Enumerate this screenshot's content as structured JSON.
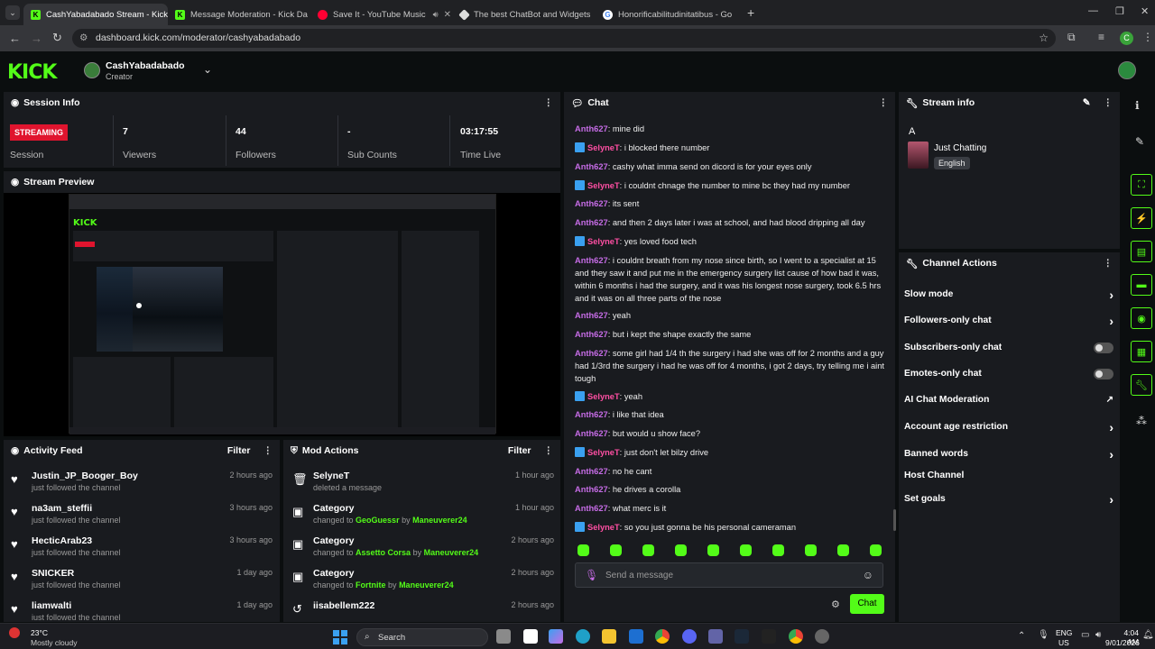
{
  "browser": {
    "tabs": [
      {
        "title": "CashYabadabado Stream - Kick",
        "color": "#53fc18"
      },
      {
        "title": "Message Moderation - Kick Da",
        "color": "#53fc18"
      },
      {
        "title": "Save It - YouTube Music",
        "color": "#ff0033"
      },
      {
        "title": "The best ChatBot and Widgets",
        "color": "#dddddd"
      },
      {
        "title": "Honorificabilitudinitatibus - Go",
        "color": "#ffffff"
      }
    ],
    "url": "dashboard.kick.com/moderator/cashyabadabado"
  },
  "header": {
    "logo": "KICK",
    "channel": "CashYabadabado",
    "role": "Creator"
  },
  "session": {
    "title": "Session Info",
    "status": "STREAMING",
    "status_label": "Session",
    "viewers": "7",
    "viewers_label": "Viewers",
    "followers": "44",
    "followers_label": "Followers",
    "subs": "-",
    "subs_label": "Sub Counts",
    "time": "03:17:55",
    "time_label": "Time Live"
  },
  "preview": {
    "title": "Stream Preview"
  },
  "activity": {
    "title": "Activity Feed",
    "filter": "Filter",
    "items": [
      {
        "name": "Justin_JP_Booger_Boy",
        "sub": "just followed the channel",
        "time": "2 hours ago"
      },
      {
        "name": "na3am_steffii",
        "sub": "just followed the channel",
        "time": "3 hours ago"
      },
      {
        "name": "HecticArab23",
        "sub": "just followed the channel",
        "time": "3 hours ago"
      },
      {
        "name": "SNICKER",
        "sub": "just followed the channel",
        "time": "1 day ago"
      },
      {
        "name": "liamwalti",
        "sub": "just followed the channel",
        "time": "1 day ago"
      }
    ]
  },
  "mod": {
    "title": "Mod Actions",
    "filter": "Filter",
    "items": [
      {
        "name": "SelyneT",
        "sub": "deleted a message",
        "time": "1 hour ago"
      },
      {
        "name": "Category",
        "pre": "changed to ",
        "game": "GeoGuessr",
        "by": " by ",
        "who": "Maneuverer24",
        "time": "1 hour ago"
      },
      {
        "name": "Category",
        "pre": "changed to ",
        "game": "Assetto Corsa",
        "by": " by ",
        "who": "Maneuverer24",
        "time": "2 hours ago"
      },
      {
        "name": "Category",
        "pre": "changed to ",
        "game": "Fortnite",
        "by": " by ",
        "who": "Maneuverer24",
        "time": "2 hours ago"
      },
      {
        "name": "iisabellem222",
        "sub": "",
        "time": "2 hours ago"
      }
    ]
  },
  "chat": {
    "title": "Chat",
    "placeholder": "Send a message",
    "send": "Chat",
    "messages": [
      {
        "user": "Anth627",
        "text": "mine did",
        "badge": false
      },
      {
        "user": "SelyneT",
        "text": "i blocked there number",
        "badge": true
      },
      {
        "user": "Anth627",
        "text": "cashy what imma send on dicord is for your eyes only",
        "badge": false
      },
      {
        "user": "SelyneT",
        "text": "i couldnt chnage the number to mine bc they had my number",
        "badge": true
      },
      {
        "user": "Anth627",
        "text": "its sent",
        "badge": false
      },
      {
        "user": "Anth627",
        "text": "and then 2 days later i was at school, and had blood dripping all day",
        "badge": false
      },
      {
        "user": "SelyneT",
        "text": "yes loved food tech",
        "badge": true
      },
      {
        "user": "Anth627",
        "text": "i couldnt breath from my nose since birth, so I went to a specialist at 15 and they saw it and put me in the emergency surgery list cause of how bad it was, within 6 months i had the surgery, and it was his longest nose surgery, took 6.5 hrs and it was on all three parts of the nose",
        "badge": false
      },
      {
        "user": "Anth627",
        "text": "yeah",
        "badge": false
      },
      {
        "user": "Anth627",
        "text": "but i kept the shape exactly the same",
        "badge": false
      },
      {
        "user": "Anth627",
        "text": "some girl had 1/4 th the surgery i had she was off for 2 months and a guy had 1/3rd the surgery i had he was off for 4 months, i got 2 days, try telling me i aint tough",
        "badge": false
      },
      {
        "user": "SelyneT",
        "text": "yeah",
        "badge": true
      },
      {
        "user": "Anth627",
        "text": "i like that idea",
        "badge": false
      },
      {
        "user": "Anth627",
        "text": "but would u show face?",
        "badge": false
      },
      {
        "user": "SelyneT",
        "text": "just don't let bilzy drive",
        "badge": true
      },
      {
        "user": "Anth627",
        "text": "no he cant",
        "badge": false
      },
      {
        "user": "Anth627",
        "text": "he drives a corolla",
        "badge": false
      },
      {
        "user": "Anth627",
        "text": "what merc is it",
        "badge": false
      },
      {
        "user": "SelyneT",
        "text": "so you just gonna be his personal cameraman",
        "badge": true
      }
    ]
  },
  "streaminfo": {
    "title": "Stream info",
    "letter": "A",
    "category": "Just Chatting",
    "language": "English"
  },
  "channel_actions": {
    "title": "Channel Actions",
    "items": [
      {
        "label": "Slow mode",
        "ctrl": "chevron"
      },
      {
        "label": "Followers-only chat",
        "ctrl": "chevron"
      },
      {
        "label": "Subscribers-only chat",
        "ctrl": "toggle"
      },
      {
        "label": "Emotes-only chat",
        "ctrl": "toggle"
      },
      {
        "label": "AI Chat Moderation",
        "ctrl": "external"
      },
      {
        "label": "Account age restriction",
        "ctrl": "chevron"
      },
      {
        "label": "Banned words",
        "ctrl": "chevron"
      },
      {
        "label": "Host Channel",
        "ctrl": "none"
      },
      {
        "label": "Set goals",
        "ctrl": "chevron"
      }
    ]
  },
  "taskbar": {
    "temp": "23°C",
    "weather": "Mostly cloudy",
    "search": "Search",
    "lang1": "ENG",
    "lang2": "US",
    "time": "4:04 AM",
    "date": "9/01/2026"
  },
  "colors": {
    "accent": "#53fc18",
    "panel": "#191b1f",
    "bg": "#0b0e0f",
    "live": "#e0142e"
  }
}
